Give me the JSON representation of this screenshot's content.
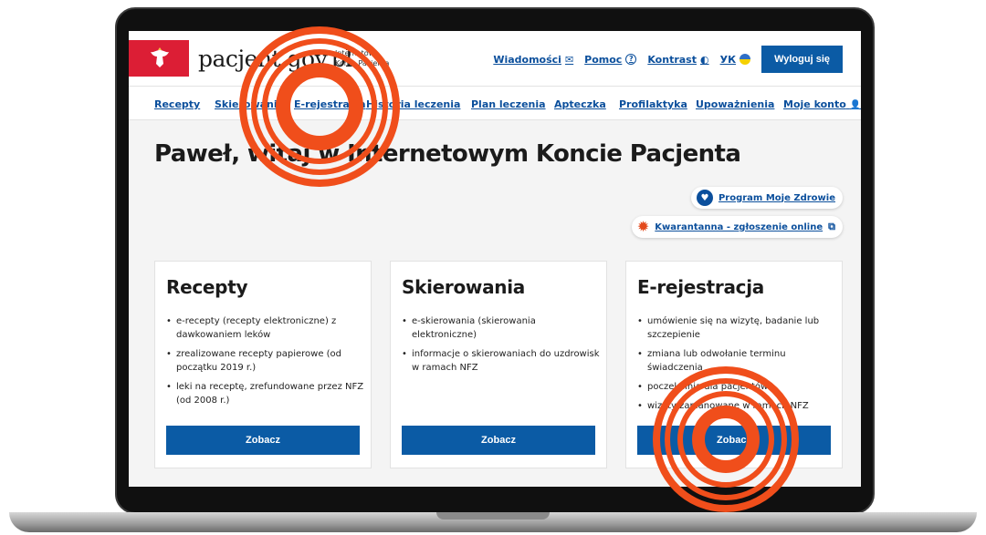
{
  "header": {
    "brand": "pacjent.gov.pl",
    "brand_sub": "Internetowe Konto Pacjenta",
    "links": [
      {
        "label": "Wiadomości",
        "icon": "envelope-icon",
        "glyph": "✉"
      },
      {
        "label": "Pomoc",
        "icon": "help-icon",
        "glyph": "?"
      },
      {
        "label": "Kontrast",
        "icon": "contrast-icon",
        "glyph": "◐"
      },
      {
        "label": "УК",
        "icon": "ukraine-flag-icon",
        "glyph": ""
      }
    ],
    "logout": "Wyloguj się"
  },
  "nav": {
    "items": [
      "Recepty",
      "Skierowania",
      "E-rejestracja",
      "Historia leczenia",
      "Plan leczenia",
      "Apteczka",
      "Profilaktyka",
      "Upoważnienia",
      "Moje konto"
    ],
    "account_icon": "👤"
  },
  "main": {
    "welcome": "Paweł, witaj w Internetowym Koncie Pacjenta",
    "pills": [
      {
        "label": "Program Moje Zdrowie",
        "icon": "heart-badge-icon",
        "glyph": "♥"
      },
      {
        "label": "Kwarantanna - zgłoszenie online",
        "icon": "virus-icon",
        "glyph": "✹",
        "ext_glyph": "⧉"
      }
    ],
    "cards": [
      {
        "title": "Recepty",
        "items": [
          "e-recepty (recepty elektroniczne) z dawkowaniem leków",
          "zrealizowane recepty papierowe (od początku 2019 r.)",
          "leki na receptę, zrefundowane przez NFZ (od 2008 r.)"
        ],
        "button": "Zobacz"
      },
      {
        "title": "Skierowania",
        "items": [
          "e-skierowania (skierowania elektroniczne)",
          "informacje o skierowaniach do uzdrowisk w ramach NFZ"
        ],
        "button": "Zobacz"
      },
      {
        "title": "E-rejestracja",
        "items": [
          "umówienie się na wizytę, badanie lub szczepienie",
          "zmiana lub odwołanie terminu świadczenia",
          "poczekalnia dla pacjentów",
          "wizyty zaplanowane w ramach NFZ"
        ],
        "button": "Zobacz"
      }
    ]
  },
  "colors": {
    "primary": "#0b5ba5",
    "link": "#0b4f9c",
    "brand_red": "#dc1e35",
    "highlight_ring": "#f04e1b"
  }
}
